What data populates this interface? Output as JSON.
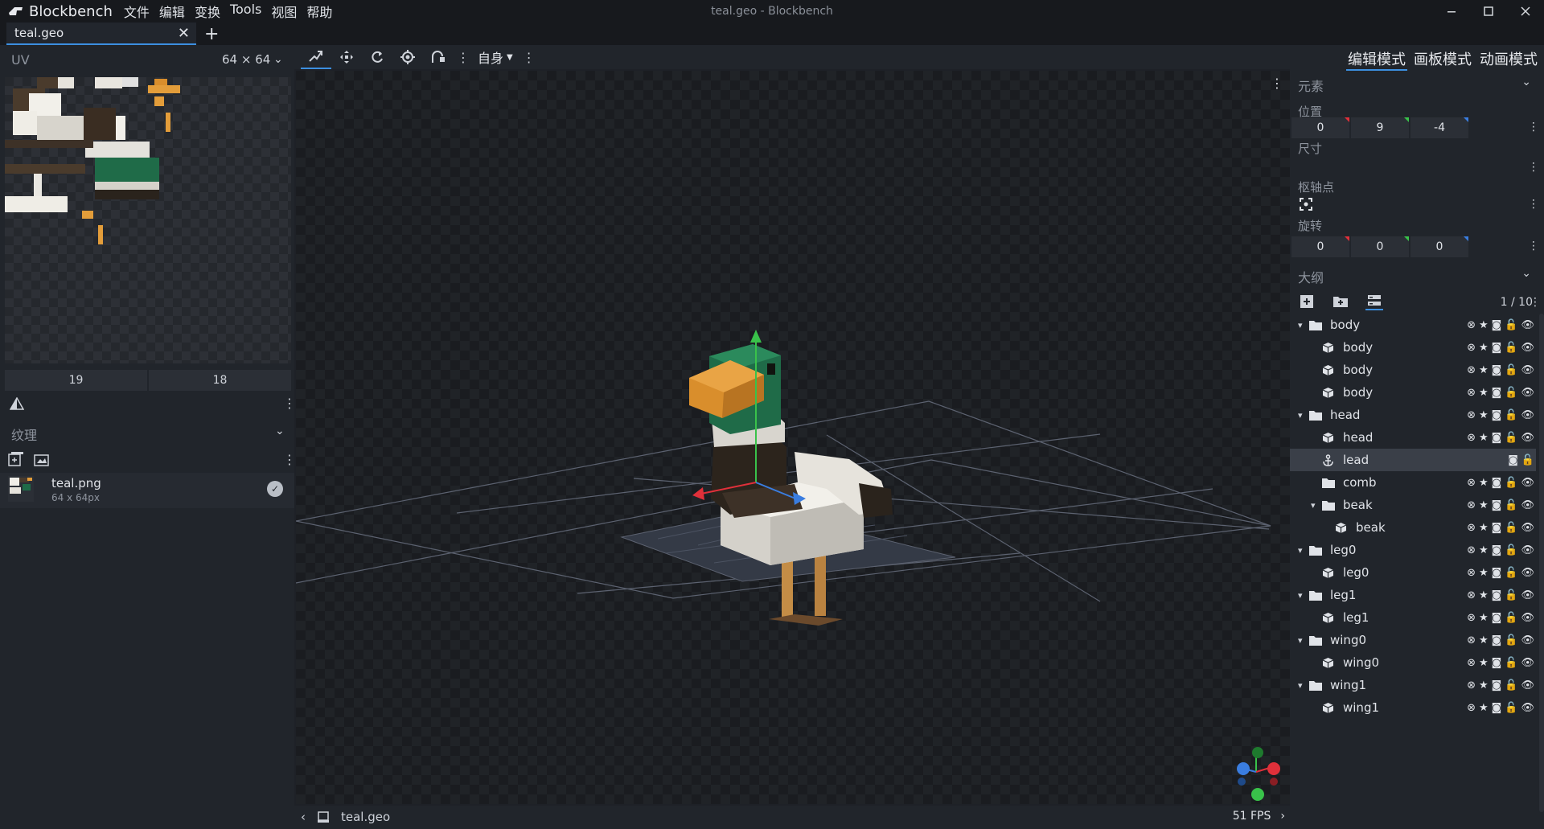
{
  "app": {
    "name": "Blockbench",
    "window_title": "teal.geo - Blockbench",
    "menu": [
      "文件",
      "编辑",
      "变换",
      "Tools",
      "视图",
      "帮助"
    ]
  },
  "tabs": [
    {
      "label": "teal.geo"
    }
  ],
  "uv_panel": {
    "title": "UV",
    "size": "64 × 64",
    "values": [
      "19",
      "18"
    ]
  },
  "texture_panel": {
    "title": "纹理",
    "items": [
      {
        "name": "teal.png",
        "size": "64 x 64px"
      }
    ]
  },
  "toolbar": {
    "space_dropdown": "自身",
    "tools": [
      "move-tool-icon",
      "resize-icon",
      "rotate-icon",
      "pivot-icon",
      "mirror-icon"
    ]
  },
  "status": {
    "file": "teal.geo",
    "fps": "51 FPS"
  },
  "modes": {
    "edit": "编辑模式",
    "paint": "画板模式",
    "animate": "动画模式"
  },
  "element_panel": {
    "title": "元素",
    "position_label": "位置",
    "position": [
      "0",
      "9",
      "-4"
    ],
    "size_label": "尺寸",
    "pivot_label": "枢轴点",
    "rotation_label": "旋转",
    "rotation": [
      "0",
      "0",
      "0"
    ]
  },
  "outliner": {
    "title": "大纲",
    "counter": "1 / 10",
    "rows": [
      {
        "label": "body",
        "type": "group",
        "depth": 0
      },
      {
        "label": "body",
        "type": "cube",
        "depth": 1
      },
      {
        "label": "body",
        "type": "cube",
        "depth": 1
      },
      {
        "label": "body",
        "type": "cube",
        "depth": 1
      },
      {
        "label": "head",
        "type": "group",
        "depth": 0
      },
      {
        "label": "head",
        "type": "cube",
        "depth": 1
      },
      {
        "label": "lead",
        "type": "locator",
        "depth": 1,
        "selected": true
      },
      {
        "label": "comb",
        "type": "group-empty",
        "depth": 1
      },
      {
        "label": "beak",
        "type": "group",
        "depth": 1
      },
      {
        "label": "beak",
        "type": "cube",
        "depth": 2
      },
      {
        "label": "leg0",
        "type": "group",
        "depth": 0
      },
      {
        "label": "leg0",
        "type": "cube",
        "depth": 1
      },
      {
        "label": "leg1",
        "type": "group",
        "depth": 0
      },
      {
        "label": "leg1",
        "type": "cube",
        "depth": 1
      },
      {
        "label": "wing0",
        "type": "group",
        "depth": 0
      },
      {
        "label": "wing0",
        "type": "cube",
        "depth": 1
      },
      {
        "label": "wing1",
        "type": "group",
        "depth": 0
      },
      {
        "label": "wing1",
        "type": "cube",
        "depth": 1
      }
    ]
  },
  "colors": {
    "accent": "#3c8fe0",
    "x_axis": "#e0303a",
    "y_axis": "#39c24a",
    "z_axis": "#3a7de0"
  }
}
